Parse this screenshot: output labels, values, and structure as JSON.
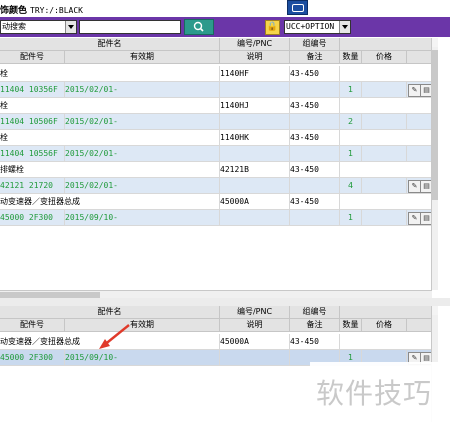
{
  "title": {
    "label": "饰颜色",
    "sub": "TRY:/:BLACK"
  },
  "toolbar": {
    "mode_select": "动搜索",
    "search_placeholder": "",
    "option_select": "UCC+OPTION"
  },
  "top_table": {
    "group_headers": [
      "配件名",
      "编号/PNC",
      "组编号"
    ],
    "columns": [
      "配件号",
      "有效期",
      "说明",
      "备注",
      "数量",
      "价格"
    ],
    "groups": [
      {
        "name": "栓",
        "pnc": "1140HF",
        "group": "43-450",
        "part": "11404 10356F",
        "date": "2015/02/01-",
        "qty": "1"
      },
      {
        "name": "栓",
        "pnc": "1140HJ",
        "group": "43-450",
        "part": "11404 10506F",
        "date": "2015/02/01-",
        "qty": "2"
      },
      {
        "name": "栓",
        "pnc": "1140HK",
        "group": "43-450",
        "part": "11404 10556F",
        "date": "2015/02/01-",
        "qty": "1"
      },
      {
        "name": "排螺栓",
        "pnc": "42121B",
        "group": "43-450",
        "part": "42121 21720",
        "date": "2015/02/01-",
        "qty": "4"
      },
      {
        "name": "动变速器／变扭器总成",
        "pnc": "45000A",
        "group": "43-450",
        "part": "45000 2F300",
        "date": "2015/09/10-",
        "qty": "1"
      }
    ]
  },
  "bottom_table": {
    "group_headers": [
      "配件名",
      "编号/PNC",
      "组编号"
    ],
    "columns": [
      "配件号",
      "有效期",
      "说明",
      "备注",
      "数量",
      "价格"
    ],
    "rows": [
      {
        "name": "动变速器／变扭器总成",
        "pnc": "45000A",
        "group": "43-450",
        "part": "45000 2F300",
        "date": "2015/09/10-",
        "qty": "1"
      }
    ]
  },
  "watermark": "软件技巧",
  "colors": {
    "toolbar": "#6b36a8",
    "green_text": "#1f9a3a",
    "alt_row": "#dde8f5"
  }
}
